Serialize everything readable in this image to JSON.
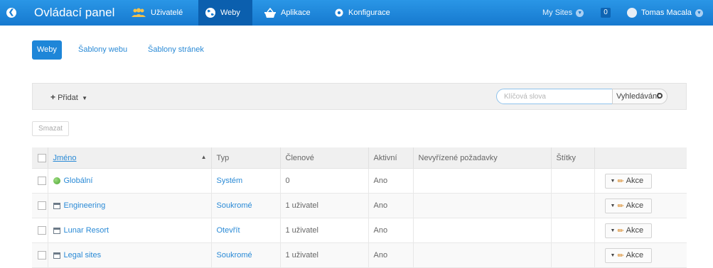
{
  "header": {
    "title": "Ovládací panel",
    "nav": [
      {
        "label": "Uživatelé",
        "icon": "users-icon",
        "active": false
      },
      {
        "label": "Weby",
        "icon": "globe-icon",
        "active": true
      },
      {
        "label": "Aplikace",
        "icon": "basket-icon",
        "active": false
      },
      {
        "label": "Konfigurace",
        "icon": "gear-icon",
        "active": false
      }
    ],
    "my_sites": "My Sites",
    "notifications": "0",
    "user_name": "Tomas Macala",
    "colors": {
      "bar": "#1a82d8",
      "active_nav": "#0b5fae"
    }
  },
  "subtabs": [
    {
      "label": "Weby",
      "active": true
    },
    {
      "label": "Šablony webu",
      "active": false
    },
    {
      "label": "Šablony stránek",
      "active": false
    }
  ],
  "toolbar": {
    "add_label": "Přidat",
    "search_placeholder": "Klíčová slova",
    "search_value": "",
    "search_button": "Vyhledávání"
  },
  "delete_label": "Smazat",
  "table": {
    "columns": [
      "Jméno",
      "Typ",
      "Členové",
      "Aktivní",
      "Nevyřízené požadavky",
      "Štítky"
    ],
    "rows": [
      {
        "name": "Globální",
        "icon": "globe-icon",
        "type": "Systém",
        "members": "0",
        "active": "Ano",
        "pending": "",
        "tags": "",
        "action": "Akce"
      },
      {
        "name": "Engineering",
        "icon": "site-icon",
        "type": "Soukromé",
        "members": "1 uživatel",
        "active": "Ano",
        "pending": "",
        "tags": "",
        "action": "Akce"
      },
      {
        "name": "Lunar Resort",
        "icon": "site-icon",
        "type": "Otevřít",
        "members": "1 uživatel",
        "active": "Ano",
        "pending": "",
        "tags": "",
        "action": "Akce"
      },
      {
        "name": "Legal sites",
        "icon": "site-icon",
        "type": "Soukromé",
        "members": "1 uživatel",
        "active": "Ano",
        "pending": "",
        "tags": "",
        "action": "Akce"
      }
    ]
  }
}
